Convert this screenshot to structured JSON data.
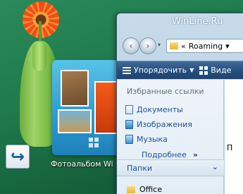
{
  "desktop": {
    "gadget_label": "Фотоальбом Wi",
    "watermark": "WinLine.Ru"
  },
  "window": {
    "address": {
      "separator": "«",
      "path": "Roaming",
      "dropdown_glyph": "▾"
    },
    "toolbar": {
      "organize_label": "Упорядочить",
      "views_label": "Виде"
    },
    "nav_pane": {
      "favorites_heading": "Избранные ссылки",
      "links": [
        "Документы",
        "Изображения",
        "Музыка"
      ],
      "more_label": "Подробнее",
      "more_glyph": "»",
      "folders_label": "Папки",
      "folders_chevron": "⌄",
      "tree_item": "Office"
    },
    "content_partial_char": "П"
  },
  "icons": [
    "back-icon",
    "forward-icon",
    "folder-icon",
    "organize-icon",
    "views-icon",
    "documents-icon",
    "images-icon",
    "music-icon",
    "shortcut-arrow-icon"
  ]
}
